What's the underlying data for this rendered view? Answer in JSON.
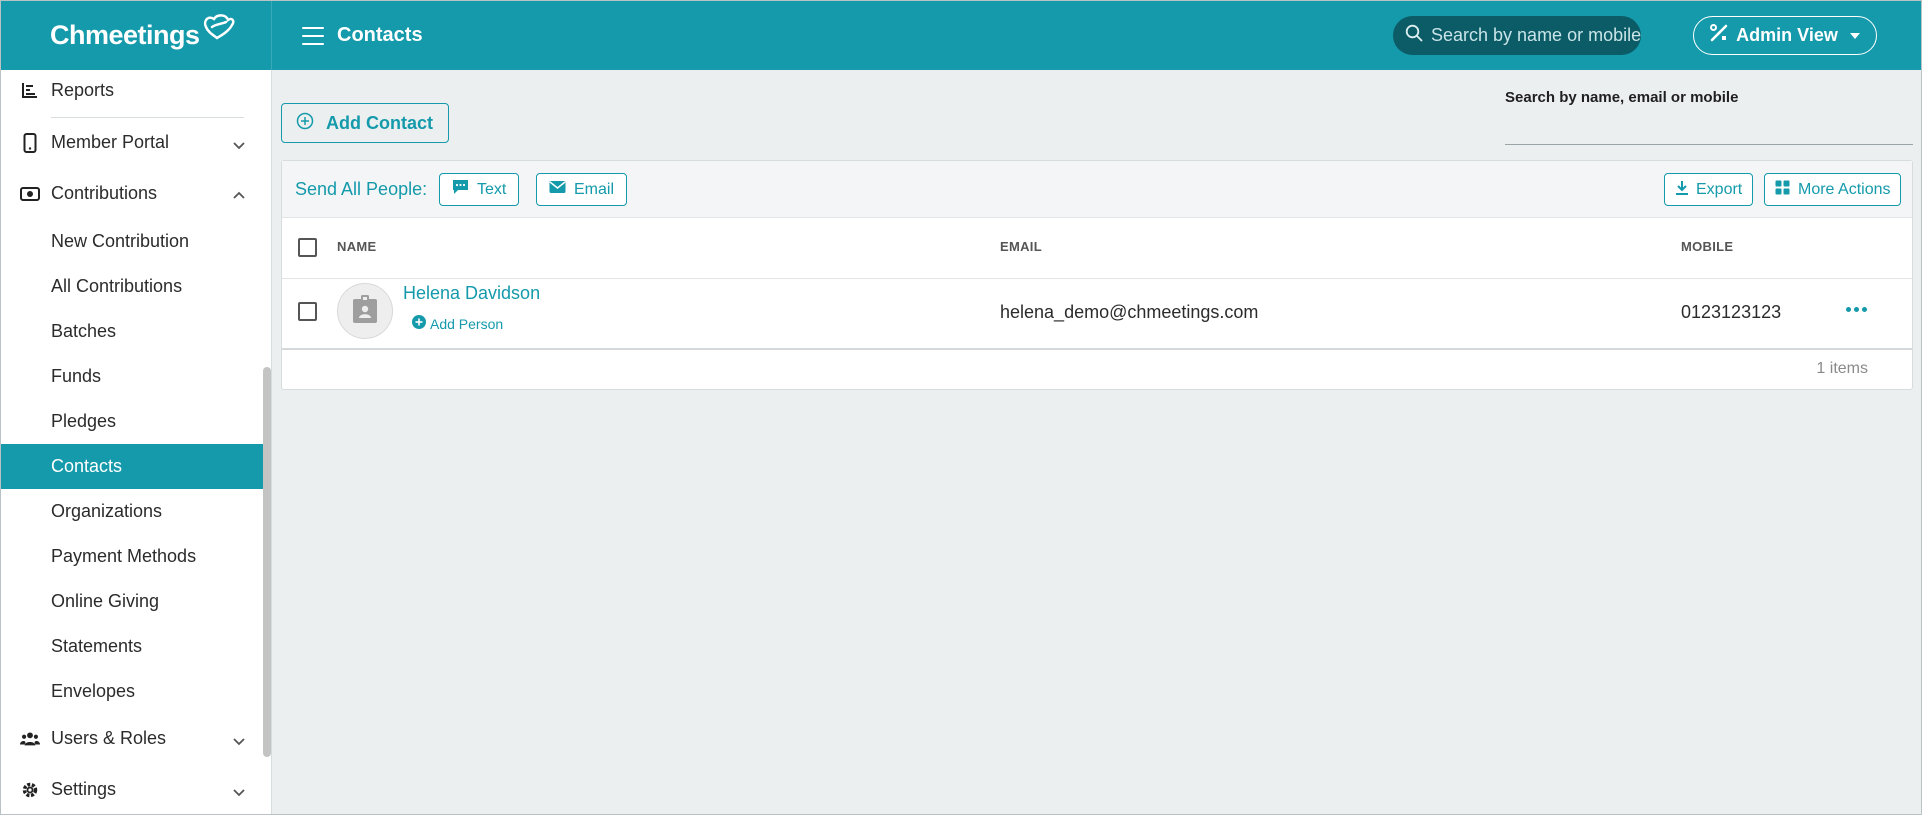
{
  "header": {
    "brand": "Chmeetings",
    "page_title": "Contacts",
    "search_placeholder": "Search by name or mobile",
    "admin_view_label": "Admin View"
  },
  "sidebar": {
    "items": [
      {
        "label": "Reports",
        "icon": "bar-chart-icon"
      },
      {
        "label": "Member Portal",
        "icon": "mobile-icon"
      },
      {
        "label": "Contributions",
        "icon": "money-icon"
      },
      {
        "label": "New Contribution"
      },
      {
        "label": "All Contributions"
      },
      {
        "label": "Batches"
      },
      {
        "label": "Funds"
      },
      {
        "label": "Pledges"
      },
      {
        "label": "Contacts"
      },
      {
        "label": "Organizations"
      },
      {
        "label": "Payment Methods"
      },
      {
        "label": "Online Giving"
      },
      {
        "label": "Statements"
      },
      {
        "label": "Envelopes"
      },
      {
        "label": "Users & Roles",
        "icon": "users-icon"
      },
      {
        "label": "Settings",
        "icon": "gear-icon"
      }
    ],
    "active": "Contacts"
  },
  "main": {
    "add_contact_label": "Add Contact",
    "filter_label": "Search by name, email or mobile",
    "send_all_label": "Send All People:",
    "text_button": "Text",
    "email_button": "Email",
    "export_button": "Export",
    "more_actions_button": "More Actions",
    "columns": [
      "NAME",
      "EMAIL",
      "MOBILE"
    ],
    "rows": [
      {
        "name": "Helena Davidson",
        "add_person": "Add Person",
        "email": "helena_demo@chmeetings.com",
        "mobile": "0123123123"
      }
    ],
    "items_count": "1 items"
  },
  "colors": {
    "accent": "#149aab",
    "search_bg": "#0b5c66",
    "page_bg": "#eceff0"
  }
}
